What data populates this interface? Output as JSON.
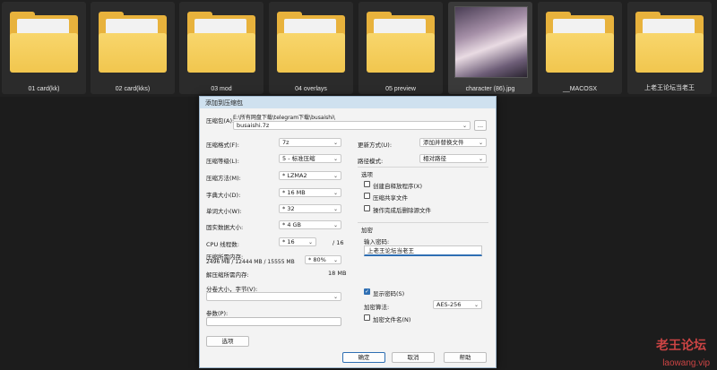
{
  "explorer": {
    "items": [
      {
        "label": "01 card(kk)",
        "kind": "folder",
        "thumb": "anime-portrait"
      },
      {
        "label": "02 card(kks)",
        "kind": "folder",
        "thumb": "anime-portrait"
      },
      {
        "label": "03 mod",
        "kind": "folder",
        "thumb": "document"
      },
      {
        "label": "04 overlays",
        "kind": "folder",
        "thumb": "disc"
      },
      {
        "label": "05 preview",
        "kind": "folder",
        "thumb": "anime-group"
      },
      {
        "label": "character (86).jpg",
        "kind": "image",
        "thumb": "photo"
      },
      {
        "label": "__MACOSX",
        "kind": "folder",
        "thumb": "document"
      },
      {
        "label": "上老王论坛当老王",
        "kind": "folder",
        "thumb": "document-stack"
      }
    ]
  },
  "dialog": {
    "title": "添加到压缩包",
    "archive": {
      "label": "压缩包(A):",
      "path": "E:\\所有网盘下载\\telegram下载\\busaishi\\",
      "name": "busaishi.7z",
      "browse": "..."
    },
    "left": {
      "format": {
        "label": "压缩格式(F):",
        "value": "7z"
      },
      "level": {
        "label": "压缩等级(L):",
        "value": "5 - 标准压缩"
      },
      "method": {
        "label": "压缩方法(M):",
        "value": "* LZMA2"
      },
      "dict": {
        "label": "字典大小(D):",
        "value": "* 16 MB"
      },
      "word": {
        "label": "单词大小(W):",
        "value": "* 32"
      },
      "solid": {
        "label": "固实数据大小:",
        "value": "* 4 GB"
      },
      "threads": {
        "label": "CPU 线程数:",
        "value": "* 16",
        "max": "/ 16"
      },
      "memory": {
        "label": "压缩所需内存:",
        "detail": "2496 MB / 12444 MB / 15555 MB",
        "value": "* 80%"
      },
      "decomp": {
        "label": "解压缩所需内存:",
        "value": "18 MB"
      },
      "split": {
        "label": "分卷大小，字节(V):",
        "value": ""
      },
      "params": {
        "label": "参数(P):",
        "value": ""
      },
      "options_button": "选项"
    },
    "right": {
      "update": {
        "label": "更新方式(U):",
        "value": "添加并替换文件"
      },
      "pathmode": {
        "label": "路径模式:",
        "value": "相对路径"
      },
      "options": {
        "title": "选项",
        "sfx": "创建自释放程序(X)",
        "shared": "压缩共享文件",
        "delete": "操作完成后删除源文件"
      },
      "encryption": {
        "title": "加密",
        "pwd_label": "输入密码:",
        "pwd_value": "上老王论坛当老王",
        "show_pwd": "显示密码(S)",
        "method_label": "加密算法:",
        "method_value": "AES-256",
        "names": "加密文件名(N)"
      }
    },
    "buttons": {
      "ok": "确定",
      "cancel": "取消",
      "help": "帮助"
    }
  },
  "watermark": {
    "line1": "老王论坛",
    "line2": "laowang.vip"
  }
}
